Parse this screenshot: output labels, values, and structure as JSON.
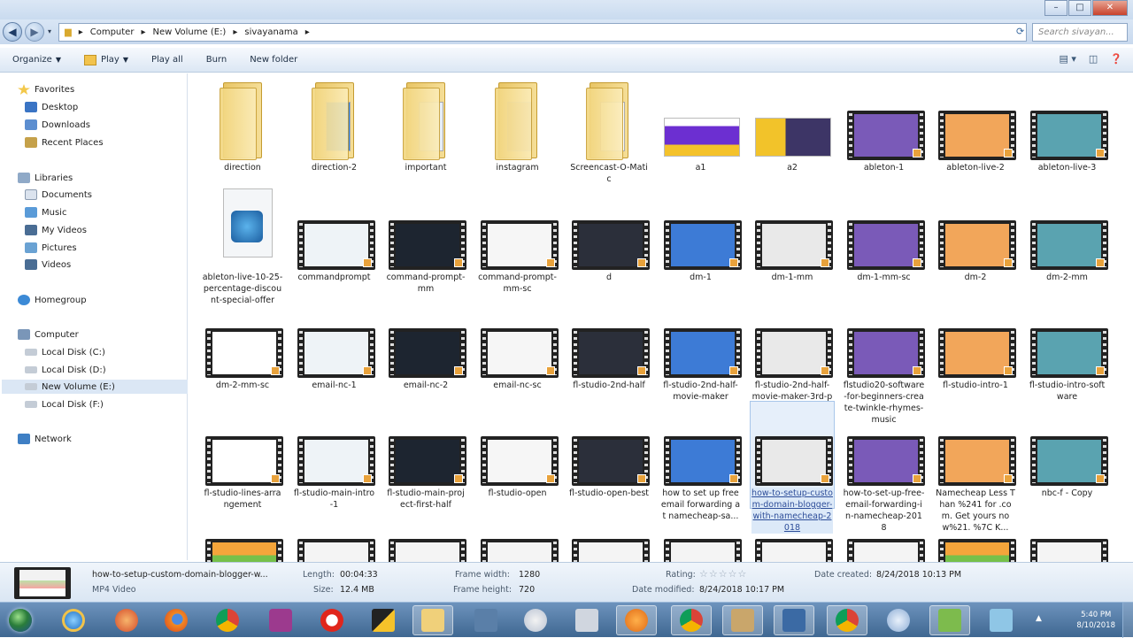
{
  "address": {
    "crumbs": [
      "Computer",
      "New Volume (E:)",
      "sivayanama"
    ],
    "search_placeholder": "Search sivayan..."
  },
  "toolbar": {
    "organize": "Organize",
    "play": "Play",
    "play_all": "Play all",
    "burn": "Burn",
    "new_folder": "New folder"
  },
  "sidebar": {
    "favorites": "Favorites",
    "desktop": "Desktop",
    "downloads": "Downloads",
    "recent": "Recent Places",
    "libraries": "Libraries",
    "documents": "Documents",
    "music": "Music",
    "my_videos": "My Videos",
    "pictures": "Pictures",
    "videos": "Videos",
    "homegroup": "Homegroup",
    "computer": "Computer",
    "local_c": "Local Disk (C:)",
    "local_d": "Local Disk (D:)",
    "new_volume_e": "New Volume (E:)",
    "local_f": "Local Disk (F:)",
    "network": "Network"
  },
  "files": [
    {
      "name": "direction",
      "kind": "folder"
    },
    {
      "name": "direction-2",
      "kind": "folder"
    },
    {
      "name": "important",
      "kind": "folder"
    },
    {
      "name": "instagram",
      "kind": "folder"
    },
    {
      "name": "Screencast-O-Matic",
      "kind": "folder"
    },
    {
      "name": "a1",
      "kind": "image"
    },
    {
      "name": "a2",
      "kind": "image"
    },
    {
      "name": "ableton-1",
      "kind": "video"
    },
    {
      "name": "ableton-live-2",
      "kind": "video"
    },
    {
      "name": "ableton-live-3",
      "kind": "video"
    },
    {
      "name": "ableton-live-10-25-percentage-discount-special-offer",
      "kind": "media"
    },
    {
      "name": "commandprompt",
      "kind": "video"
    },
    {
      "name": "command-prompt-mm",
      "kind": "video"
    },
    {
      "name": "command-prompt-mm-sc",
      "kind": "video"
    },
    {
      "name": "d",
      "kind": "video"
    },
    {
      "name": "dm-1",
      "kind": "video"
    },
    {
      "name": "dm-1-mm",
      "kind": "video"
    },
    {
      "name": "dm-1-mm-sc",
      "kind": "video"
    },
    {
      "name": "dm-2",
      "kind": "video"
    },
    {
      "name": "dm-2-mm",
      "kind": "video"
    },
    {
      "name": "dm-2-mm-sc",
      "kind": "video"
    },
    {
      "name": "email-nc-1",
      "kind": "video"
    },
    {
      "name": "email-nc-2",
      "kind": "video"
    },
    {
      "name": "email-nc-sc",
      "kind": "video"
    },
    {
      "name": "fl-studio-2nd-half",
      "kind": "video"
    },
    {
      "name": "fl-studio-2nd-half-movie-maker",
      "kind": "video"
    },
    {
      "name": "fl-studio-2nd-half-movie-maker-3rd-part",
      "kind": "video"
    },
    {
      "name": "flstudio20-software-for-beginners-create-twinkle-rhymes-music",
      "kind": "video"
    },
    {
      "name": "fl-studio-intro-1",
      "kind": "video"
    },
    {
      "name": "fl-studio-intro-software",
      "kind": "video"
    },
    {
      "name": "fl-studio-lines-arrangement",
      "kind": "video"
    },
    {
      "name": "fl-studio-main-intro-1",
      "kind": "video"
    },
    {
      "name": "fl-studio-main-project-first-half",
      "kind": "video"
    },
    {
      "name": "fl-studio-open",
      "kind": "video"
    },
    {
      "name": "fl-studio-open-best",
      "kind": "video"
    },
    {
      "name": "how to set up free email forwarding at namecheap-sa...",
      "kind": "video"
    },
    {
      "name": "how-to-setup-custom-domain-blogger-with-namecheap-2018",
      "kind": "video",
      "selected": true
    },
    {
      "name": "how-to-set-up-free-email-forwarding-in-namecheap-2018",
      "kind": "video"
    },
    {
      "name": "Namecheap Less Than %241 for .com. Get yours now%21. %7C K...",
      "kind": "video"
    },
    {
      "name": "nbc-f - Copy",
      "kind": "video"
    }
  ],
  "details": {
    "filename": "how-to-setup-custom-domain-blogger-w...",
    "filetype": "MP4 Video",
    "length_label": "Length:",
    "length": "00:04:33",
    "size_label": "Size:",
    "size": "12.4 MB",
    "frame_width_label": "Frame width:",
    "frame_width": "1280",
    "frame_height_label": "Frame height:",
    "frame_height": "720",
    "rating_label": "Rating:",
    "rating": 0,
    "date_modified_label": "Date modified:",
    "date_modified": "8/24/2018 10:17 PM",
    "date_created_label": "Date created:",
    "date_created": "8/24/2018 10:13 PM"
  },
  "taskbar": {
    "time": "5:40 PM",
    "date": "8/10/2018"
  },
  "colors": {
    "folder": "#f2d67f",
    "selection": "#e6effa",
    "taskbar": "#4f78a3"
  }
}
